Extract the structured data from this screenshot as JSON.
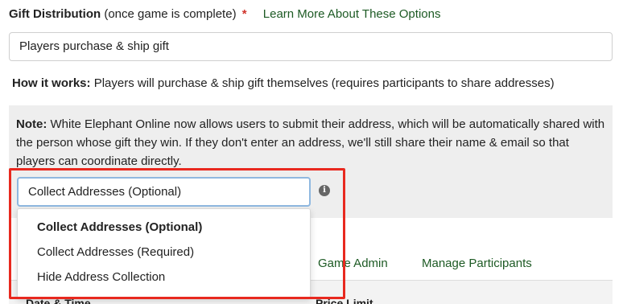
{
  "gift_distribution": {
    "label": "Gift Distribution",
    "qualifier": "(once game is complete)",
    "required_marker": "*",
    "learn_more": "Learn More About These Options",
    "selected": "Players purchase & ship gift"
  },
  "how_it_works": {
    "label": "How it works:",
    "text": "Players will purchase & ship gift themselves (requires participants to share addresses)"
  },
  "note": {
    "label": "Note:",
    "text": "White Elephant Online now allows users to submit their address, which will be automatically shared with the person whose gift they win. If they don't enter an address, we'll still share their name & email so that players can coordinate directly."
  },
  "address_select": {
    "selected": "Collect Addresses (Optional)",
    "info_icon": "info-icon",
    "options": [
      "Collect Addresses (Optional)",
      "Collect Addresses (Required)",
      "Hide Address Collection"
    ]
  },
  "tabs": {
    "game_admin": "Game Admin",
    "manage_participants": "Manage Participants"
  },
  "table": {
    "col_date_time": "Date & Time",
    "col_price_limit": "Price Limit"
  },
  "colors": {
    "accent_green": "#1d5a24",
    "highlight_red": "#e8291f",
    "required_red": "#d0342c"
  }
}
